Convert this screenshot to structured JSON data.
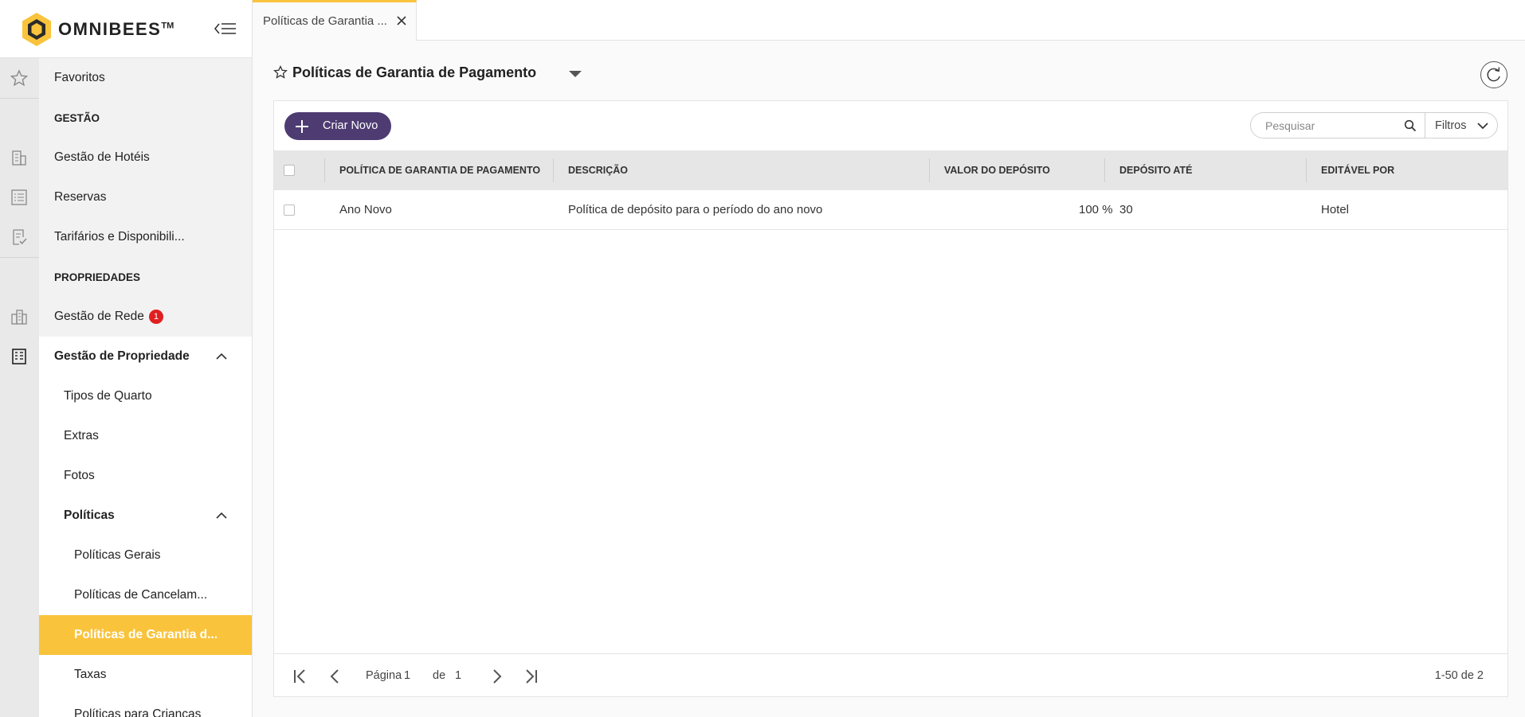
{
  "app": {
    "brand": "OMNIBEES",
    "trademark": "TM"
  },
  "sidebar": {
    "items": [
      {
        "label": "Favoritos"
      },
      {
        "label": "GESTÃO"
      },
      {
        "label": "Gestão de Hotéis"
      },
      {
        "label": "Reservas"
      },
      {
        "label": "Tarifários e Disponibili..."
      },
      {
        "label": "PROPRIEDADES"
      },
      {
        "label": "Gestão de Rede",
        "badge": "1"
      },
      {
        "label": "Gestão de Propriedade"
      },
      {
        "label": "Tipos de Quarto"
      },
      {
        "label": "Extras"
      },
      {
        "label": "Fotos"
      },
      {
        "label": "Políticas"
      },
      {
        "label": "Políticas Gerais"
      },
      {
        "label": "Políticas de Cancelam..."
      },
      {
        "label": "Políticas de Garantia d..."
      },
      {
        "label": "Taxas"
      },
      {
        "label": "Políticas para Crianças"
      }
    ]
  },
  "tabs": [
    {
      "label": "Políticas de Garantia ..."
    }
  ],
  "page": {
    "title": "Políticas de Garantia de Pagamento"
  },
  "toolbar": {
    "create_label": "Criar Novo",
    "search_placeholder": "Pesquisar",
    "filters_label": "Filtros"
  },
  "table": {
    "columns": [
      "POLÍTICA DE GARANTIA DE PAGAMENTO",
      "DESCRIÇÃO",
      "VALOR DO DEPÓSITO",
      "DEPÓSITO ATÉ",
      "EDITÁVEL POR"
    ],
    "rows": [
      [
        "Ano Novo",
        "Política de depósito para o período do ano novo",
        "100 %",
        "30",
        "Hotel"
      ]
    ]
  },
  "pagination": {
    "page_label": "Página",
    "current_page": "1",
    "of_label": "de",
    "total_pages": "1",
    "range": "1-50 de 2"
  },
  "colors": {
    "accent": "#f9c33c",
    "primary": "#4d3b72",
    "badge": "#e02020"
  }
}
